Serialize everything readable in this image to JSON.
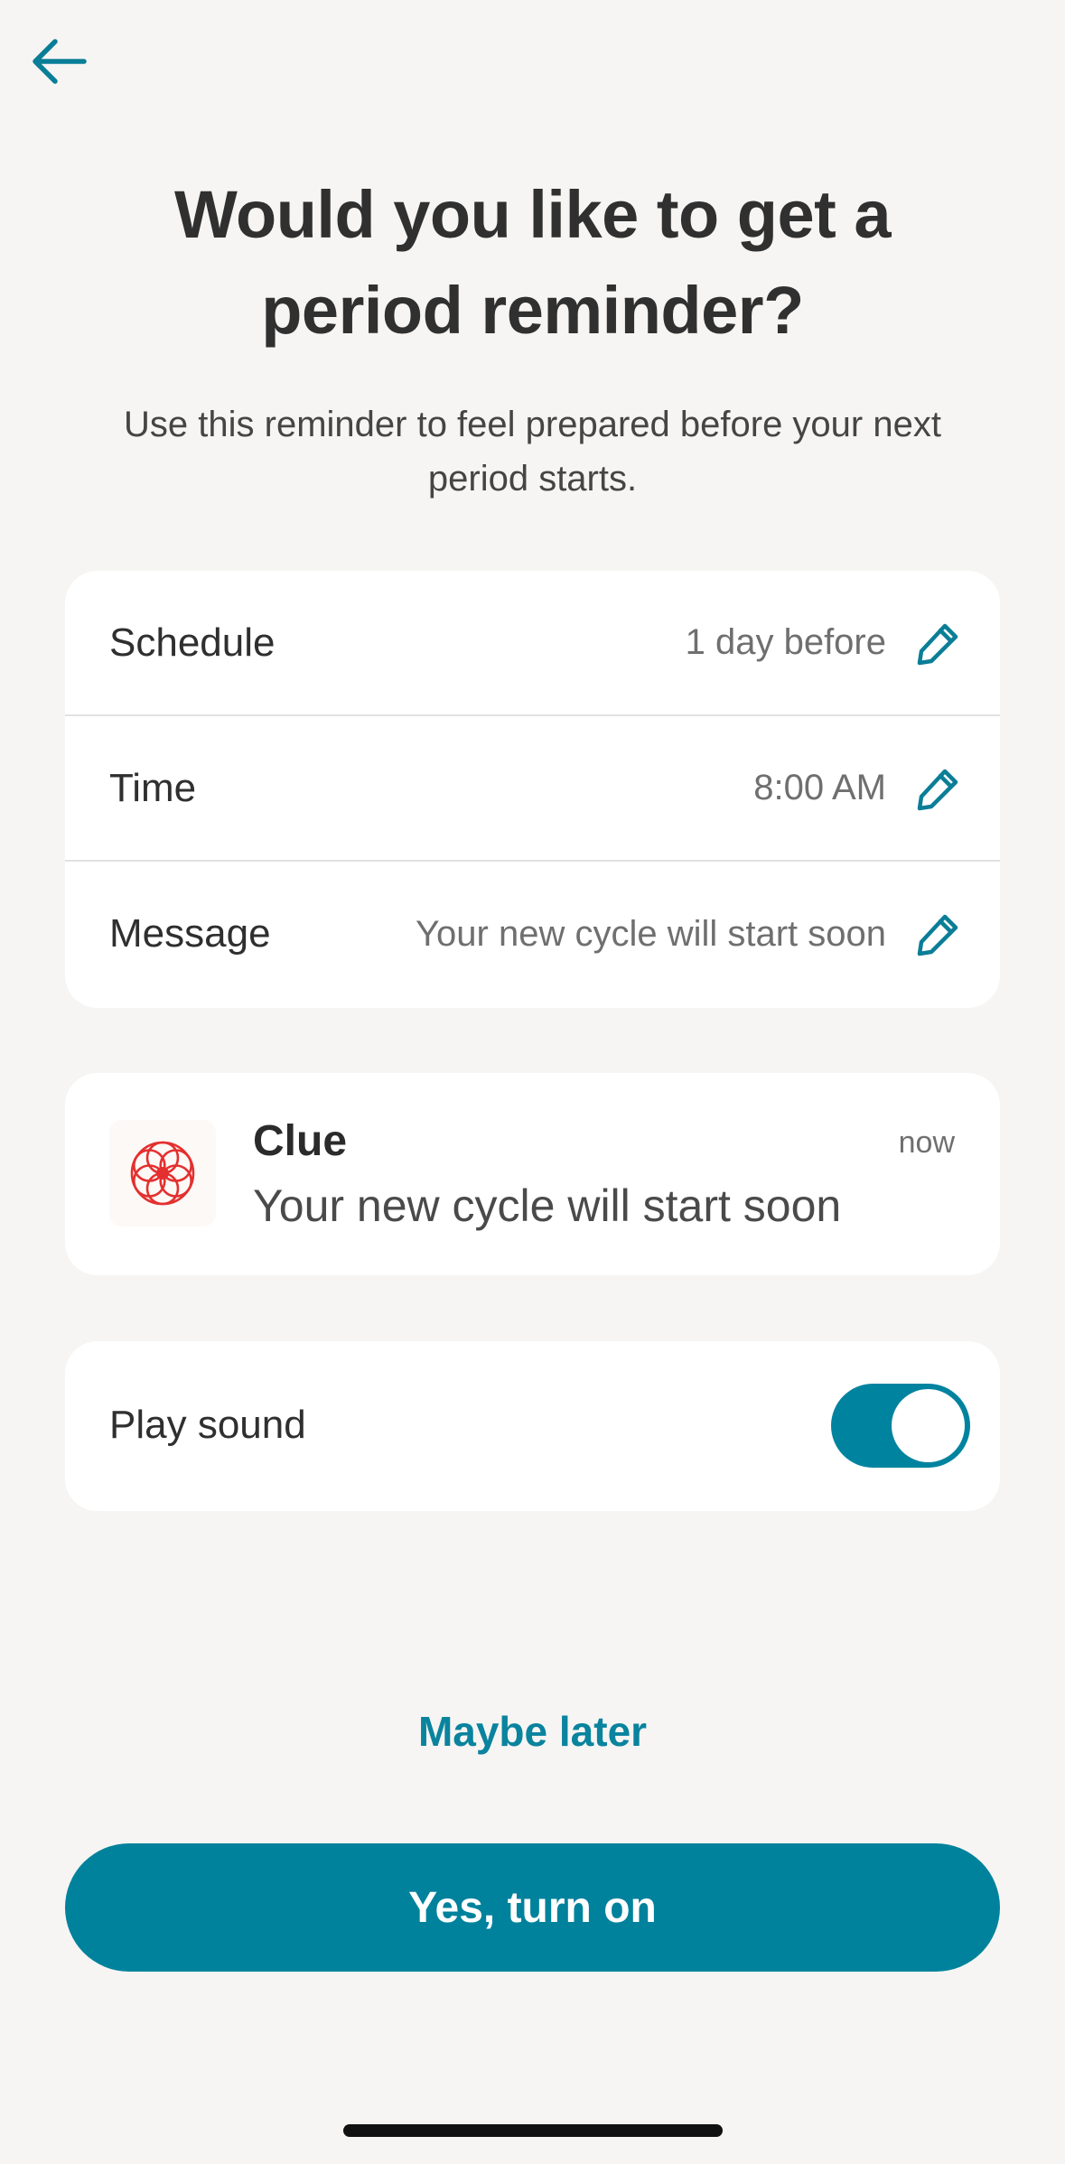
{
  "header": {
    "back_icon": "arrow-left-icon",
    "title": "Would you like to get a period reminder?",
    "subtitle": "Use this reminder to feel prepared before your next period starts."
  },
  "settings": [
    {
      "label": "Schedule",
      "value": "1 day before",
      "icon": "pencil-icon"
    },
    {
      "label": "Time",
      "value": "8:00 AM",
      "icon": "pencil-icon"
    },
    {
      "label": "Message",
      "value": "Your new cycle will start soon",
      "icon": "pencil-icon"
    }
  ],
  "notification_preview": {
    "app_icon": "clue-flower-icon",
    "app_name": "Clue",
    "time": "now",
    "message": "Your new cycle will start soon"
  },
  "sound": {
    "label": "Play sound",
    "enabled": true
  },
  "actions": {
    "secondary_label": "Maybe later",
    "primary_label": "Yes, turn on"
  },
  "colors": {
    "accent": "#00839f",
    "background": "#f6f5f3",
    "card": "#ffffff",
    "logo_red": "#e3302f"
  }
}
